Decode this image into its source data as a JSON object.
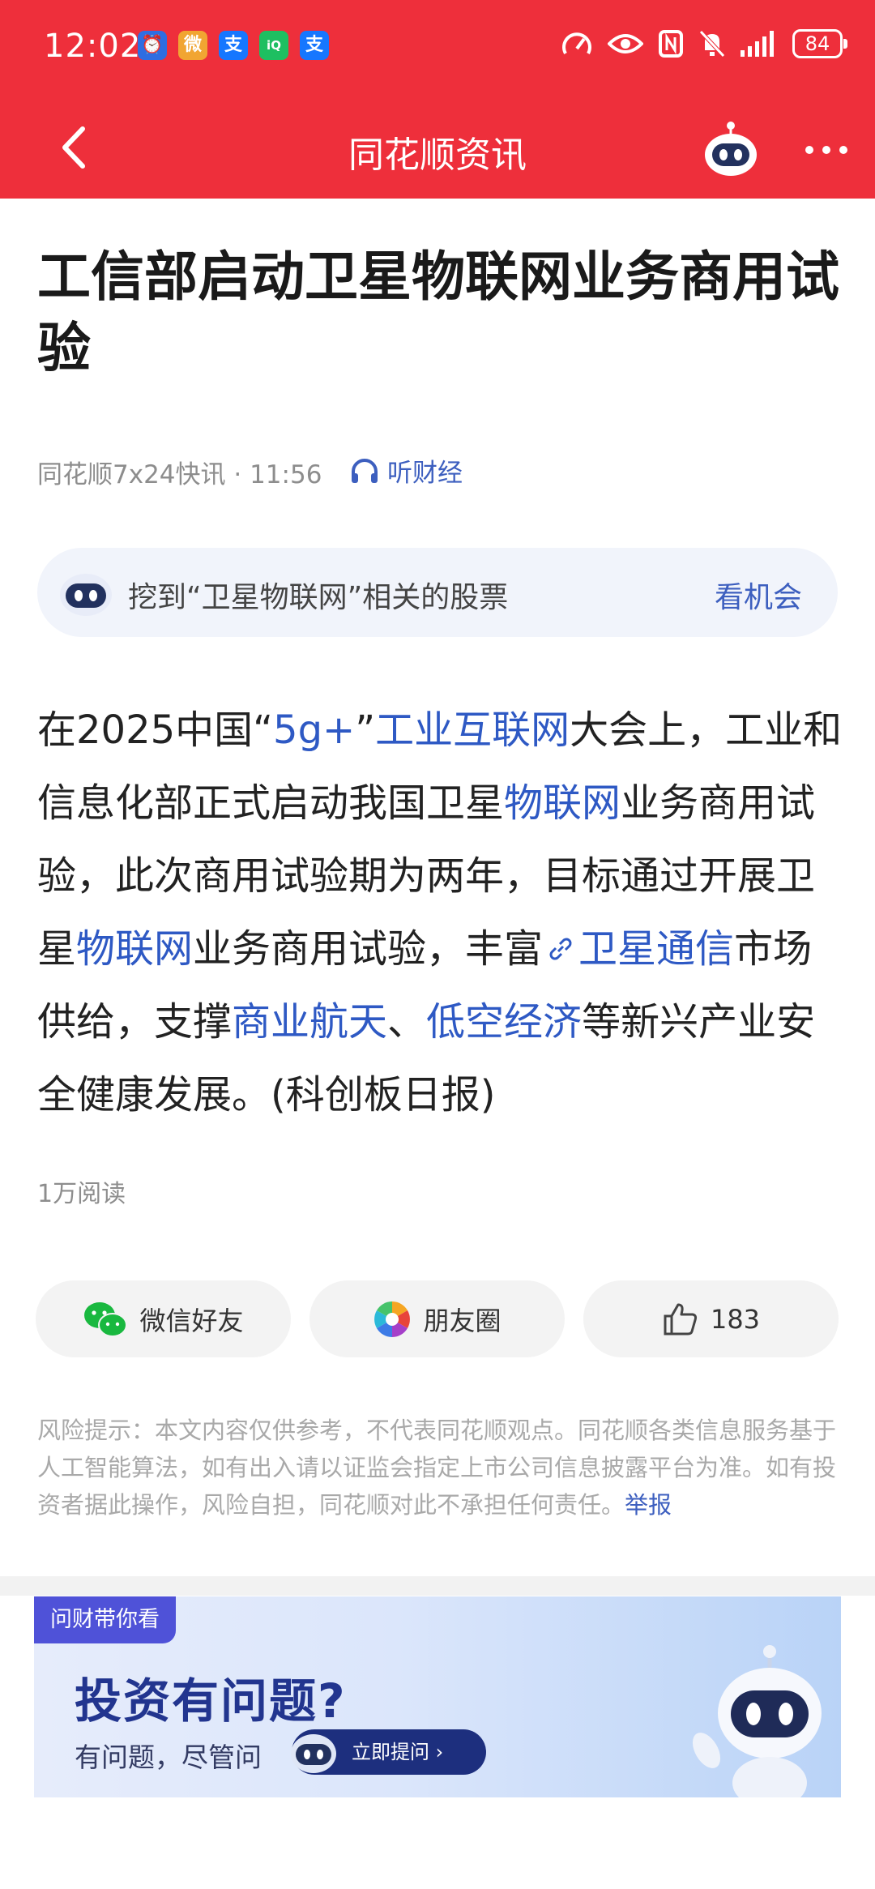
{
  "status_bar": {
    "time": "12:02",
    "notif_icons": [
      {
        "name": "clock-app-icon",
        "text": "⏰",
        "color": "#2f6de1"
      },
      {
        "name": "weibo-icon",
        "text": "微",
        "color": "#f1a532"
      },
      {
        "name": "alipay-icon",
        "text": "支",
        "color": "#1677ff"
      },
      {
        "name": "iqiyi-icon",
        "text": "iQ",
        "color": "#1ebf61"
      },
      {
        "name": "alipay-icon-2",
        "text": "支",
        "color": "#1677ff"
      }
    ],
    "battery": "84"
  },
  "nav": {
    "title": "同花顺资讯"
  },
  "article": {
    "title": "工信部启动卫星物联网业务商用试验",
    "source": "同花顺7x24快讯 · 11:56",
    "listen_label": "听财经",
    "stock_tip": {
      "text": "挖到“卫星物联网”相关的股票",
      "link": "看机会"
    },
    "body": {
      "s1": "在2025中国“",
      "k1": "5g+",
      "s2": "”",
      "k2": "工业互联网",
      "s3": "大会上，工业和信息化部正式启动我国卫星",
      "k3": "物联网",
      "s4": "业务商用试验，此次商用试验期为两年，目标通过开展卫星",
      "k4": "物联网",
      "s5": "业务商用试验，丰富",
      "k5": "卫星通信",
      "s6": "市场供给，支撑",
      "k6": "商业航天",
      "s7": "、",
      "k7": "低空经济",
      "s8": "等新兴产业安全健康发展。(科创板日报)"
    },
    "reads": "1万阅读"
  },
  "share": {
    "wechat": "微信好友",
    "moments": "朋友圈",
    "likes": "183"
  },
  "disclaimer": {
    "text": "风险提示：本文内容仅供参考，不代表同花顺观点。同花顺各类信息服务基于人工智能算法，如有出入请以证监会指定上市公司信息披露平台为准。如有投资者据此操作，风险自担，同花顺对此不承担任何责任。",
    "report": "举报"
  },
  "banner": {
    "tag": "问财带你看",
    "headline": "投资有问题?",
    "sub": "有问题，尽管问",
    "cta": "立即提问 ›"
  },
  "colors": {
    "brand_red": "#ee2f3b",
    "link_blue": "#2e59c4"
  }
}
